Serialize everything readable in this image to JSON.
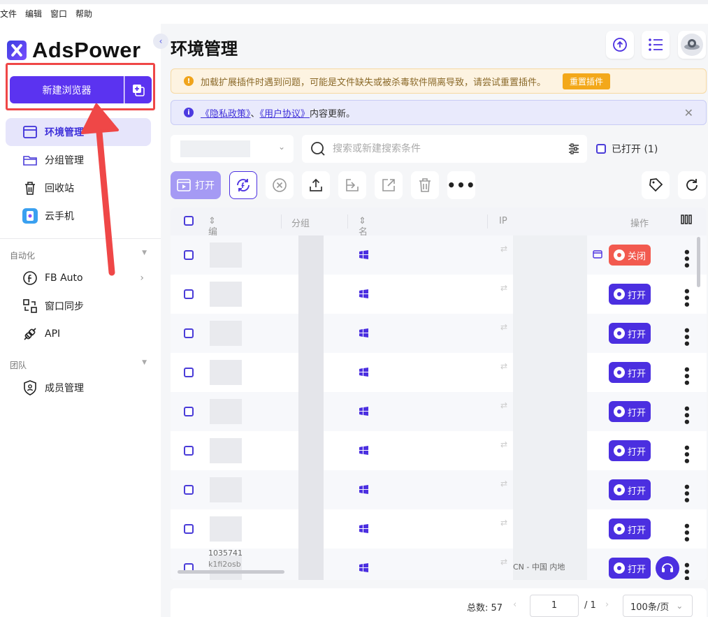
{
  "menu": [
    "文件",
    "编辑",
    "窗口",
    "帮助"
  ],
  "brand": {
    "name": "AdsPower",
    "accent": "#5b33f0"
  },
  "sidebar": {
    "new_browser_label": "新建浏览器",
    "items": [
      {
        "label": "环境管理",
        "icon": "browser-window-icon",
        "active": true
      },
      {
        "label": "分组管理",
        "icon": "folder-icon"
      },
      {
        "label": "回收站",
        "icon": "trash-icon"
      },
      {
        "label": "云手机",
        "icon": "cloud-phone-icon"
      }
    ],
    "automation": {
      "label": "自动化",
      "items": [
        {
          "label": "FB Auto",
          "icon": "facebook-icon"
        },
        {
          "label": "窗口同步",
          "icon": "window-sync-icon"
        },
        {
          "label": "API",
          "icon": "api-icon"
        }
      ]
    },
    "team": {
      "label": "团队",
      "items": [
        {
          "label": "成员管理",
          "icon": "shield-user-icon"
        }
      ]
    }
  },
  "main": {
    "title": "环境管理",
    "warning": {
      "text": "加载扩展插件时遇到问题，可能是文件缺失或被杀毒软件隔离导致，请尝试重置插件。",
      "button": "重置插件"
    },
    "notice": {
      "link1": "《隐私政策》",
      "sep": "、",
      "link2": "《用户协议》",
      "suffix": "内容更新。"
    },
    "search": {
      "placeholder": "搜索或新建搜索条件"
    },
    "opened_filter": "已打开 (1)",
    "toolbar": {
      "open_label": "打开"
    },
    "table": {
      "columns": [
        "编号/ID",
        "分组",
        "名称",
        "IP",
        "操作"
      ],
      "rows": [
        {
          "status": "关闭"
        },
        {
          "status": "打开"
        },
        {
          "status": "打开"
        },
        {
          "status": "打开"
        },
        {
          "status": "打开"
        },
        {
          "status": "打开"
        },
        {
          "status": "打开"
        },
        {
          "status": "打开"
        },
        {
          "status": "打开",
          "partial_id": "1035741",
          "partial_id2": "k1fi2osb",
          "partial_ip": "CN - 中国 内地"
        }
      ]
    },
    "footer": {
      "total": "总数: 57",
      "page": "1",
      "pages": "/ 1",
      "per_page": "100条/页"
    }
  }
}
